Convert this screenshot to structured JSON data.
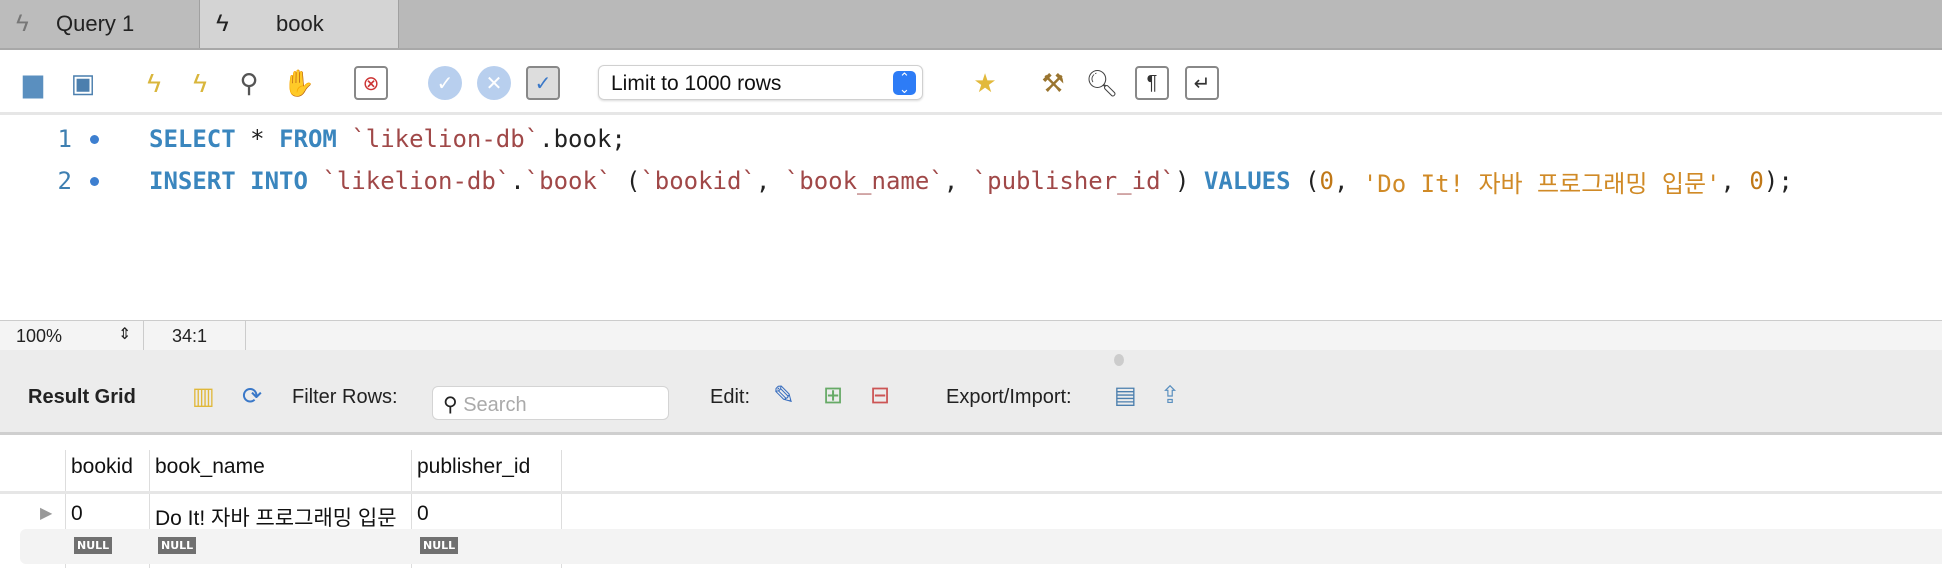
{
  "tabs": [
    {
      "label": "Query 1",
      "active": false
    },
    {
      "label": "book",
      "active": true
    }
  ],
  "toolbar": {
    "limit_select": "Limit to 1000 rows"
  },
  "editor": {
    "line1": {
      "num": "1",
      "kw1": "SELECT",
      "op": " * ",
      "kw2": "FROM",
      "sp": " ",
      "id": "`likelion-db`",
      "rest": ".book;"
    },
    "line2": {
      "num": "2",
      "kw1": "INSERT",
      "sp1": " ",
      "kw2": "INTO",
      "sp2": " ",
      "id1": "`likelion-db`",
      "dot": ".",
      "id2": "`book`",
      "p1": " (",
      "c1": "`bookid`",
      "cm1": ", ",
      "c2": "`book_name`",
      "cm2": ", ",
      "c3": "`publisher_id`",
      "p2": ") ",
      "kw3": "VALUES",
      "p3": " (",
      "v1": "0",
      "cm3": ", ",
      "v2": "'Do It! 자바 프로그래밍 입문'",
      "cm4": ", ",
      "v3": "0",
      "p4": ");"
    }
  },
  "status": {
    "zoom": "100%",
    "position": "34:1"
  },
  "result": {
    "title": "Result Grid",
    "filter_label": "Filter Rows:",
    "search_placeholder": "Search",
    "edit_label": "Edit:",
    "export_label": "Export/Import:"
  },
  "grid": {
    "columns": [
      "bookid",
      "book_name",
      "publisher_id"
    ],
    "rows": [
      [
        "0",
        "Do It! 자바 프로그래밍 입문",
        "0"
      ]
    ],
    "null_row": [
      "NULL",
      "NULL",
      "NULL"
    ]
  }
}
